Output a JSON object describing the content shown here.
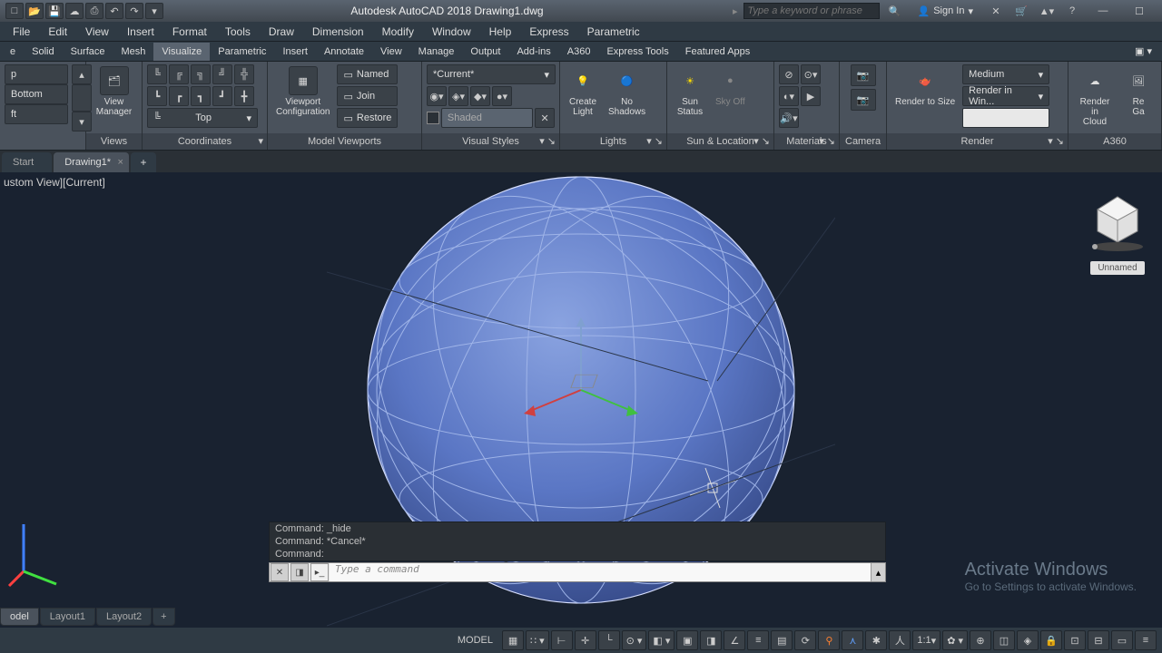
{
  "app_title": "Autodesk AutoCAD 2018   Drawing1.dwg",
  "search_placeholder": "Type a keyword or phrase",
  "sign_in": "Sign In",
  "menu": [
    "File",
    "Edit",
    "View",
    "Insert",
    "Format",
    "Tools",
    "Draw",
    "Dimension",
    "Modify",
    "Window",
    "Help",
    "Express",
    "Parametric"
  ],
  "ribbon_tabs": [
    "e",
    "Solid",
    "Surface",
    "Mesh",
    "Visualize",
    "Parametric",
    "Insert",
    "Annotate",
    "View",
    "Manage",
    "Output",
    "Add-ins",
    "A360",
    "Express Tools",
    "Featured Apps"
  ],
  "ribbon_active_tab": "Visualize",
  "views_panel": {
    "label": "Views",
    "items": [
      "p",
      "Bottom",
      "ft"
    ],
    "btn": "View\nManager"
  },
  "coords_panel": {
    "label": "Coordinates",
    "top_combo": "Top"
  },
  "viewports_panel": {
    "label": "Model Viewports",
    "named": "Named",
    "join": "Join",
    "restore": "Restore",
    "conf": "Viewport\nConfiguration"
  },
  "visualstyles_panel": {
    "label": "Visual Styles",
    "combo": "*Current*",
    "shaded": "Shaded"
  },
  "lights_panel": {
    "label": "Lights",
    "create": "Create\nLight",
    "noshadows": "No\nShadows"
  },
  "sun_panel": {
    "label": "Sun & Location",
    "sunstatus": "Sun\nStatus",
    "sky": "Sky Off"
  },
  "materials_panel": {
    "label": "Materials"
  },
  "camera_panel": {
    "label": "Camera"
  },
  "render_panel": {
    "label": "Render",
    "size": "Render to Size",
    "medium": "Medium",
    "renderwin": "Render in Win..."
  },
  "rendercloud_panel": {
    "label": "A360",
    "btn": "Render in\nCloud",
    "btn2": "Re\nGa"
  },
  "filetabs": {
    "start": "Start",
    "tab1": "Drawing1*"
  },
  "view_label": "ustom View][Current]",
  "viewcube": {
    "label": "Unnamed"
  },
  "watermark": {
    "title": "Activate Windows",
    "sub": "Go to Settings to activate Windows."
  },
  "cmd_history": [
    "Command:  _hide",
    "Command: *Cancel*",
    "Command:"
  ],
  "cmd_placeholder": "Type a command",
  "layout_tabs": [
    "odel",
    "Layout1",
    "Layout2"
  ],
  "status": {
    "model": "MODEL",
    "scale": "1:1"
  }
}
